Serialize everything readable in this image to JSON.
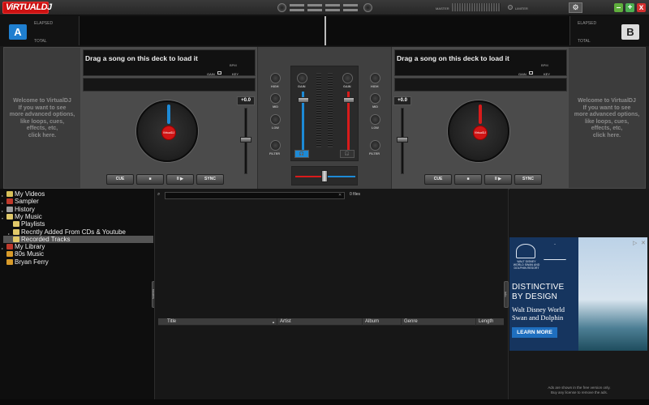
{
  "app": {
    "logo_text_a": "ViRTUAL",
    "logo_text_b": "DJ"
  },
  "titlebar": {
    "master_label": "MASTER",
    "limiter_label": "LIMITER",
    "settings_icon": "gear-icon",
    "minimize_label": "–",
    "maximize_label": "+",
    "close_label": "x"
  },
  "header": {
    "left_elapsed": "ELAPSED",
    "left_total": "TOTAL",
    "right_elapsed": "ELAPSED",
    "right_total": "TOTAL"
  },
  "deck_a": {
    "badge": "A",
    "title": "Drag a song on this deck to load it",
    "bpm_label": "BPM",
    "gain_label": "GAIN",
    "key_label": "KEY",
    "pitch_value": "+0.0",
    "platter_label": "VirtualDJ",
    "cue": "CUE",
    "stop": "■",
    "play": "II ▶",
    "sync": "SYNC",
    "accent": "#1d8ad6"
  },
  "deck_b": {
    "badge": "B",
    "title": "Drag a song on this deck to load it",
    "bpm_label": "BPM",
    "gain_label": "GAIN",
    "key_label": "KEY",
    "pitch_value": "+0.0",
    "platter_label": "VirtualDJ",
    "cue": "CUE",
    "stop": "■",
    "play": "II ▶",
    "sync": "SYNC",
    "accent": "#d81b1b"
  },
  "side_left": {
    "text": "Welcome to VirtualDJ\nIf you want to see\nmore advanced options,\nlike loops, cues,\neffects, etc,\nclick here."
  },
  "side_right": {
    "text": "Welcome to VirtualDJ\nIf you want to see\nmore advanced options,\nlike loops, cues,\neffects, etc,\nclick here."
  },
  "mixer": {
    "high": "HIGH",
    "mid": "MID",
    "low": "LOW",
    "filter": "FILTER",
    "gain": "GAIN"
  },
  "browser": {
    "tree": [
      {
        "label": "My Videos",
        "color": "#d8c15a",
        "arrow": "▸"
      },
      {
        "label": "Sampler",
        "color": "#c0392b",
        "arrow": "▸"
      },
      {
        "label": "History",
        "color": "#9e9e9e",
        "arrow": "▸"
      },
      {
        "label": "My Music",
        "color": "#e0c869",
        "arrow": "▾"
      },
      {
        "label": "Playlists",
        "color": "#e0c869",
        "arrow": ""
      },
      {
        "label": "Recntly Added From CDs & Youtube",
        "color": "#e0c869",
        "arrow": "▸"
      },
      {
        "label": "Recorded Tracks",
        "color": "#e0c869",
        "arrow": ""
      },
      {
        "label": "My Library",
        "color": "#c0392b",
        "arrow": "▸"
      },
      {
        "label": "80s Music",
        "color": "#d89b2a",
        "arrow": ""
      },
      {
        "label": "Bryan Ferry",
        "color": "#d89b2a",
        "arrow": ""
      }
    ],
    "folders_tab": "folders",
    "info_tab": "info",
    "search_value": "",
    "search_clear": "✕",
    "files_count": "0 files",
    "columns": [
      "Title",
      "Artist",
      "Album",
      "Genre",
      "Length"
    ],
    "sort_indicator": "▲"
  },
  "ad": {
    "brand": "WALT DISNEY WORLD SWAN AND DOLPHIN RESORT",
    "headline_1": "DISTINCTIVE",
    "headline_2": "BY DESIGN",
    "sub_1": "Walt Disney World",
    "sub_2": "Swan and Dolphin",
    "cta": "LEARN MORE",
    "adchoices_icon": "adchoices-icon",
    "close_icon": "close-icon",
    "note_1": "Ads are shown in the free version only.",
    "note_2": "Buy any license to remove the ads."
  }
}
